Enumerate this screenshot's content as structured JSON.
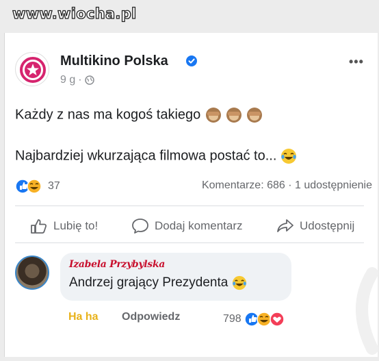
{
  "watermark": "www.wiocha.pl",
  "post": {
    "page_name": "Multikino Polska",
    "time": "9 g",
    "meta_sep": "·",
    "line1": "Każdy z nas ma kogoś takiego",
    "line2": "Najbardziej wkurzająca filmowa postać to...",
    "reaction_count": "37",
    "stats": "Komentarze: 686 · 1 udostępnienie"
  },
  "actions": {
    "like": "Lubię to!",
    "comment": "Dodaj komentarz",
    "share": "Udostępnij"
  },
  "comment": {
    "author": "Izabela Przybylska",
    "text": "Andrzej grający Prezydenta",
    "haha": "Ha ha",
    "reply": "Odpowiedz",
    "reaction_count": "798"
  },
  "colors": {
    "verified": "#1877f2",
    "like_blue": "#1877f2",
    "haha_yellow": "#f7b125",
    "love_red": "#f33e58",
    "logo_pink": "#d6246e"
  }
}
